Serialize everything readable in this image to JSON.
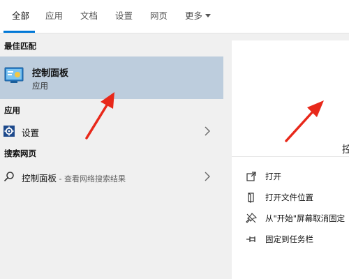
{
  "tabs": [
    {
      "label": "全部",
      "active": true
    },
    {
      "label": "应用",
      "active": false
    },
    {
      "label": "文档",
      "active": false
    },
    {
      "label": "设置",
      "active": false
    },
    {
      "label": "网页",
      "active": false
    },
    {
      "label": "更多",
      "active": false
    }
  ],
  "sections": {
    "best_match": "最佳匹配",
    "apps": "应用",
    "web": "搜索网页"
  },
  "best_match": {
    "title": "控制面板",
    "subtitle": "应用",
    "icon": "control-panel-icon"
  },
  "app_result": {
    "label": "设置",
    "icon": "gear-icon"
  },
  "web_result": {
    "label": "控制面板",
    "hint": " - 查看网络搜索结果",
    "icon": "search-icon"
  },
  "preview": {
    "title_partial": "控"
  },
  "actions": [
    {
      "label": "打开",
      "icon": "open-icon"
    },
    {
      "label": "打开文件位置",
      "icon": "file-location-icon"
    },
    {
      "label": "从\"开始\"屏幕取消固定",
      "icon": "unpin-icon"
    },
    {
      "label": "固定到任务栏",
      "icon": "pin-taskbar-icon"
    }
  ],
  "colors": {
    "accent": "#0078d7",
    "selected": "#bdcddd",
    "annotation_arrow": "#e8281a"
  }
}
